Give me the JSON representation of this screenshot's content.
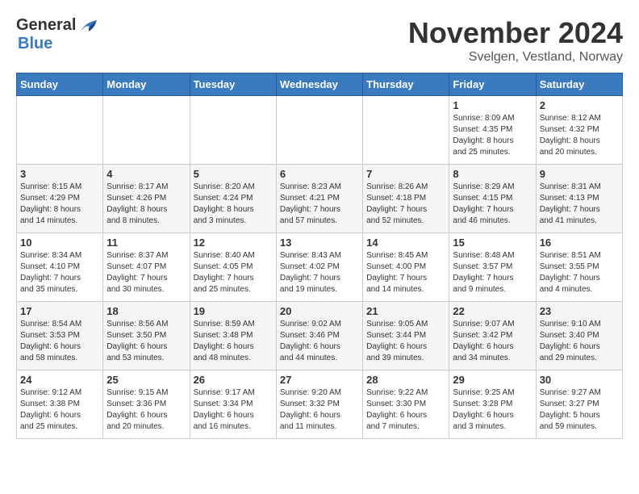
{
  "logo": {
    "general": "General",
    "blue": "Blue"
  },
  "title": "November 2024",
  "subtitle": "Svelgen, Vestland, Norway",
  "days_of_week": [
    "Sunday",
    "Monday",
    "Tuesday",
    "Wednesday",
    "Thursday",
    "Friday",
    "Saturday"
  ],
  "weeks": [
    [
      {
        "day": "",
        "info": ""
      },
      {
        "day": "",
        "info": ""
      },
      {
        "day": "",
        "info": ""
      },
      {
        "day": "",
        "info": ""
      },
      {
        "day": "",
        "info": ""
      },
      {
        "day": "1",
        "info": "Sunrise: 8:09 AM\nSunset: 4:35 PM\nDaylight: 8 hours\nand 25 minutes."
      },
      {
        "day": "2",
        "info": "Sunrise: 8:12 AM\nSunset: 4:32 PM\nDaylight: 8 hours\nand 20 minutes."
      }
    ],
    [
      {
        "day": "3",
        "info": "Sunrise: 8:15 AM\nSunset: 4:29 PM\nDaylight: 8 hours\nand 14 minutes."
      },
      {
        "day": "4",
        "info": "Sunrise: 8:17 AM\nSunset: 4:26 PM\nDaylight: 8 hours\nand 8 minutes."
      },
      {
        "day": "5",
        "info": "Sunrise: 8:20 AM\nSunset: 4:24 PM\nDaylight: 8 hours\nand 3 minutes."
      },
      {
        "day": "6",
        "info": "Sunrise: 8:23 AM\nSunset: 4:21 PM\nDaylight: 7 hours\nand 57 minutes."
      },
      {
        "day": "7",
        "info": "Sunrise: 8:26 AM\nSunset: 4:18 PM\nDaylight: 7 hours\nand 52 minutes."
      },
      {
        "day": "8",
        "info": "Sunrise: 8:29 AM\nSunset: 4:15 PM\nDaylight: 7 hours\nand 46 minutes."
      },
      {
        "day": "9",
        "info": "Sunrise: 8:31 AM\nSunset: 4:13 PM\nDaylight: 7 hours\nand 41 minutes."
      }
    ],
    [
      {
        "day": "10",
        "info": "Sunrise: 8:34 AM\nSunset: 4:10 PM\nDaylight: 7 hours\nand 35 minutes."
      },
      {
        "day": "11",
        "info": "Sunrise: 8:37 AM\nSunset: 4:07 PM\nDaylight: 7 hours\nand 30 minutes."
      },
      {
        "day": "12",
        "info": "Sunrise: 8:40 AM\nSunset: 4:05 PM\nDaylight: 7 hours\nand 25 minutes."
      },
      {
        "day": "13",
        "info": "Sunrise: 8:43 AM\nSunset: 4:02 PM\nDaylight: 7 hours\nand 19 minutes."
      },
      {
        "day": "14",
        "info": "Sunrise: 8:45 AM\nSunset: 4:00 PM\nDaylight: 7 hours\nand 14 minutes."
      },
      {
        "day": "15",
        "info": "Sunrise: 8:48 AM\nSunset: 3:57 PM\nDaylight: 7 hours\nand 9 minutes."
      },
      {
        "day": "16",
        "info": "Sunrise: 8:51 AM\nSunset: 3:55 PM\nDaylight: 7 hours\nand 4 minutes."
      }
    ],
    [
      {
        "day": "17",
        "info": "Sunrise: 8:54 AM\nSunset: 3:53 PM\nDaylight: 6 hours\nand 58 minutes."
      },
      {
        "day": "18",
        "info": "Sunrise: 8:56 AM\nSunset: 3:50 PM\nDaylight: 6 hours\nand 53 minutes."
      },
      {
        "day": "19",
        "info": "Sunrise: 8:59 AM\nSunset: 3:48 PM\nDaylight: 6 hours\nand 48 minutes."
      },
      {
        "day": "20",
        "info": "Sunrise: 9:02 AM\nSunset: 3:46 PM\nDaylight: 6 hours\nand 44 minutes."
      },
      {
        "day": "21",
        "info": "Sunrise: 9:05 AM\nSunset: 3:44 PM\nDaylight: 6 hours\nand 39 minutes."
      },
      {
        "day": "22",
        "info": "Sunrise: 9:07 AM\nSunset: 3:42 PM\nDaylight: 6 hours\nand 34 minutes."
      },
      {
        "day": "23",
        "info": "Sunrise: 9:10 AM\nSunset: 3:40 PM\nDaylight: 6 hours\nand 29 minutes."
      }
    ],
    [
      {
        "day": "24",
        "info": "Sunrise: 9:12 AM\nSunset: 3:38 PM\nDaylight: 6 hours\nand 25 minutes."
      },
      {
        "day": "25",
        "info": "Sunrise: 9:15 AM\nSunset: 3:36 PM\nDaylight: 6 hours\nand 20 minutes."
      },
      {
        "day": "26",
        "info": "Sunrise: 9:17 AM\nSunset: 3:34 PM\nDaylight: 6 hours\nand 16 minutes."
      },
      {
        "day": "27",
        "info": "Sunrise: 9:20 AM\nSunset: 3:32 PM\nDaylight: 6 hours\nand 11 minutes."
      },
      {
        "day": "28",
        "info": "Sunrise: 9:22 AM\nSunset: 3:30 PM\nDaylight: 6 hours\nand 7 minutes."
      },
      {
        "day": "29",
        "info": "Sunrise: 9:25 AM\nSunset: 3:28 PM\nDaylight: 6 hours\nand 3 minutes."
      },
      {
        "day": "30",
        "info": "Sunrise: 9:27 AM\nSunset: 3:27 PM\nDaylight: 5 hours\nand 59 minutes."
      }
    ]
  ]
}
